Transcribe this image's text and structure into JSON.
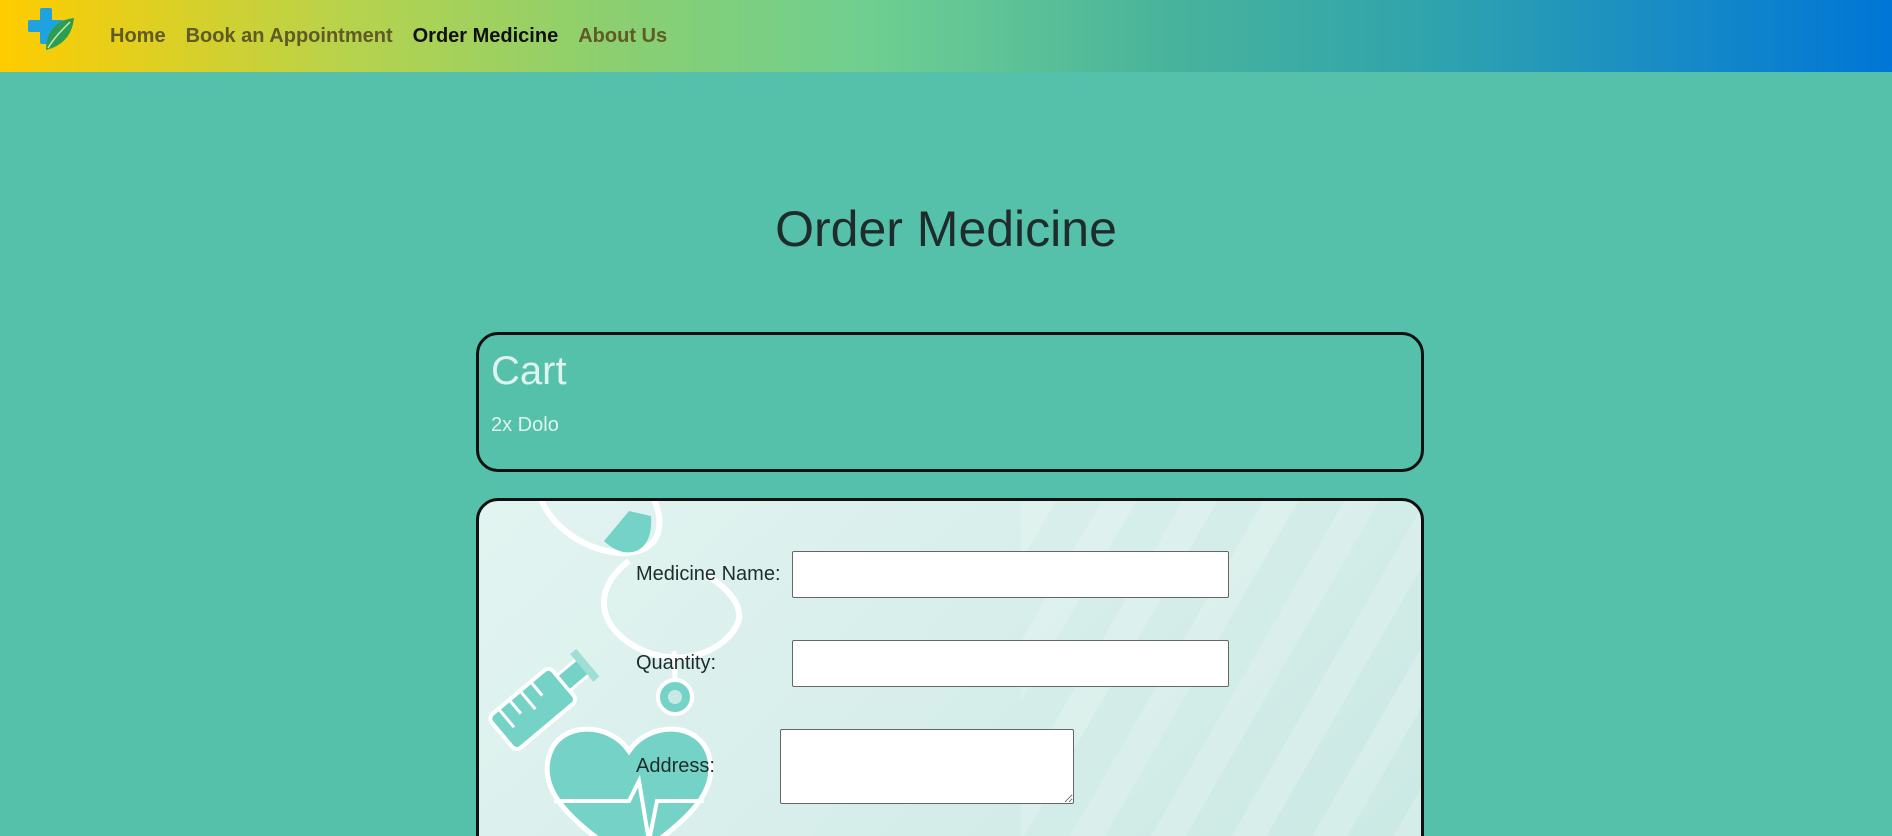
{
  "nav": {
    "logo_icon": "medical-cross-leaf-icon",
    "items": [
      {
        "label": "Home",
        "active": false
      },
      {
        "label": "Book an Appointment",
        "active": false
      },
      {
        "label": "Order Medicine",
        "active": true
      },
      {
        "label": "About Us",
        "active": false
      }
    ]
  },
  "page": {
    "title": "Order Medicine"
  },
  "cart": {
    "title": "Cart",
    "items": [
      "2x Dolo"
    ]
  },
  "form": {
    "medicine_name_label": "Medicine Name:",
    "medicine_name_value": "",
    "quantity_label": "Quantity:",
    "quantity_value": "",
    "address_label": "Address:",
    "address_value": ""
  },
  "colors": {
    "page_background": "#56c1aa",
    "nav_gradient_start": "#ffcc00",
    "nav_gradient_end": "#0076d6",
    "form_background": "#d7eeea",
    "decoration_teal": "#74d3c6"
  },
  "decorations": [
    "stethoscope-icon",
    "syringe-icon",
    "heart-pulse-icon"
  ]
}
